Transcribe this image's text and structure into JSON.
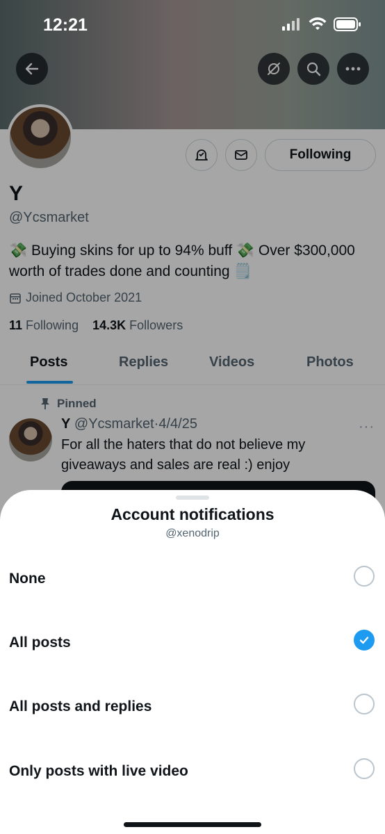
{
  "status_bar": {
    "time": "12:21"
  },
  "profile": {
    "display_name": "Y",
    "handle": "@Ycsmarket",
    "bio_line1": "💸 Buying skins for up to 94% buff 💸 Over $300,000",
    "bio_line2": "worth of trades done and counting 🗒️",
    "joined": "Joined October 2021",
    "following_count": "11",
    "following_label": "Following",
    "followers_count": "14.3K",
    "followers_label": "Followers",
    "follow_button": "Following"
  },
  "tabs": [
    {
      "label": "Posts"
    },
    {
      "label": "Replies"
    },
    {
      "label": "Videos"
    },
    {
      "label": "Photos"
    }
  ],
  "pinned_post": {
    "pinned_label": "Pinned",
    "name": "Y",
    "handle": "@Ycsmarket",
    "separator": "·",
    "date": "4/4/25",
    "text": "For all the haters that do not believe my giveaways and sales are real :) enjoy",
    "more": "···"
  },
  "sheet": {
    "title": "Account notifications",
    "subtitle": "@xenodrip",
    "options": [
      {
        "label": "None",
        "selected": false
      },
      {
        "label": "All posts",
        "selected": true
      },
      {
        "label": "All posts and replies",
        "selected": false
      },
      {
        "label": "Only posts with live video",
        "selected": false
      }
    ]
  },
  "colors": {
    "accent": "#1d9bf0",
    "text": "#0f1419",
    "muted": "#536471"
  }
}
